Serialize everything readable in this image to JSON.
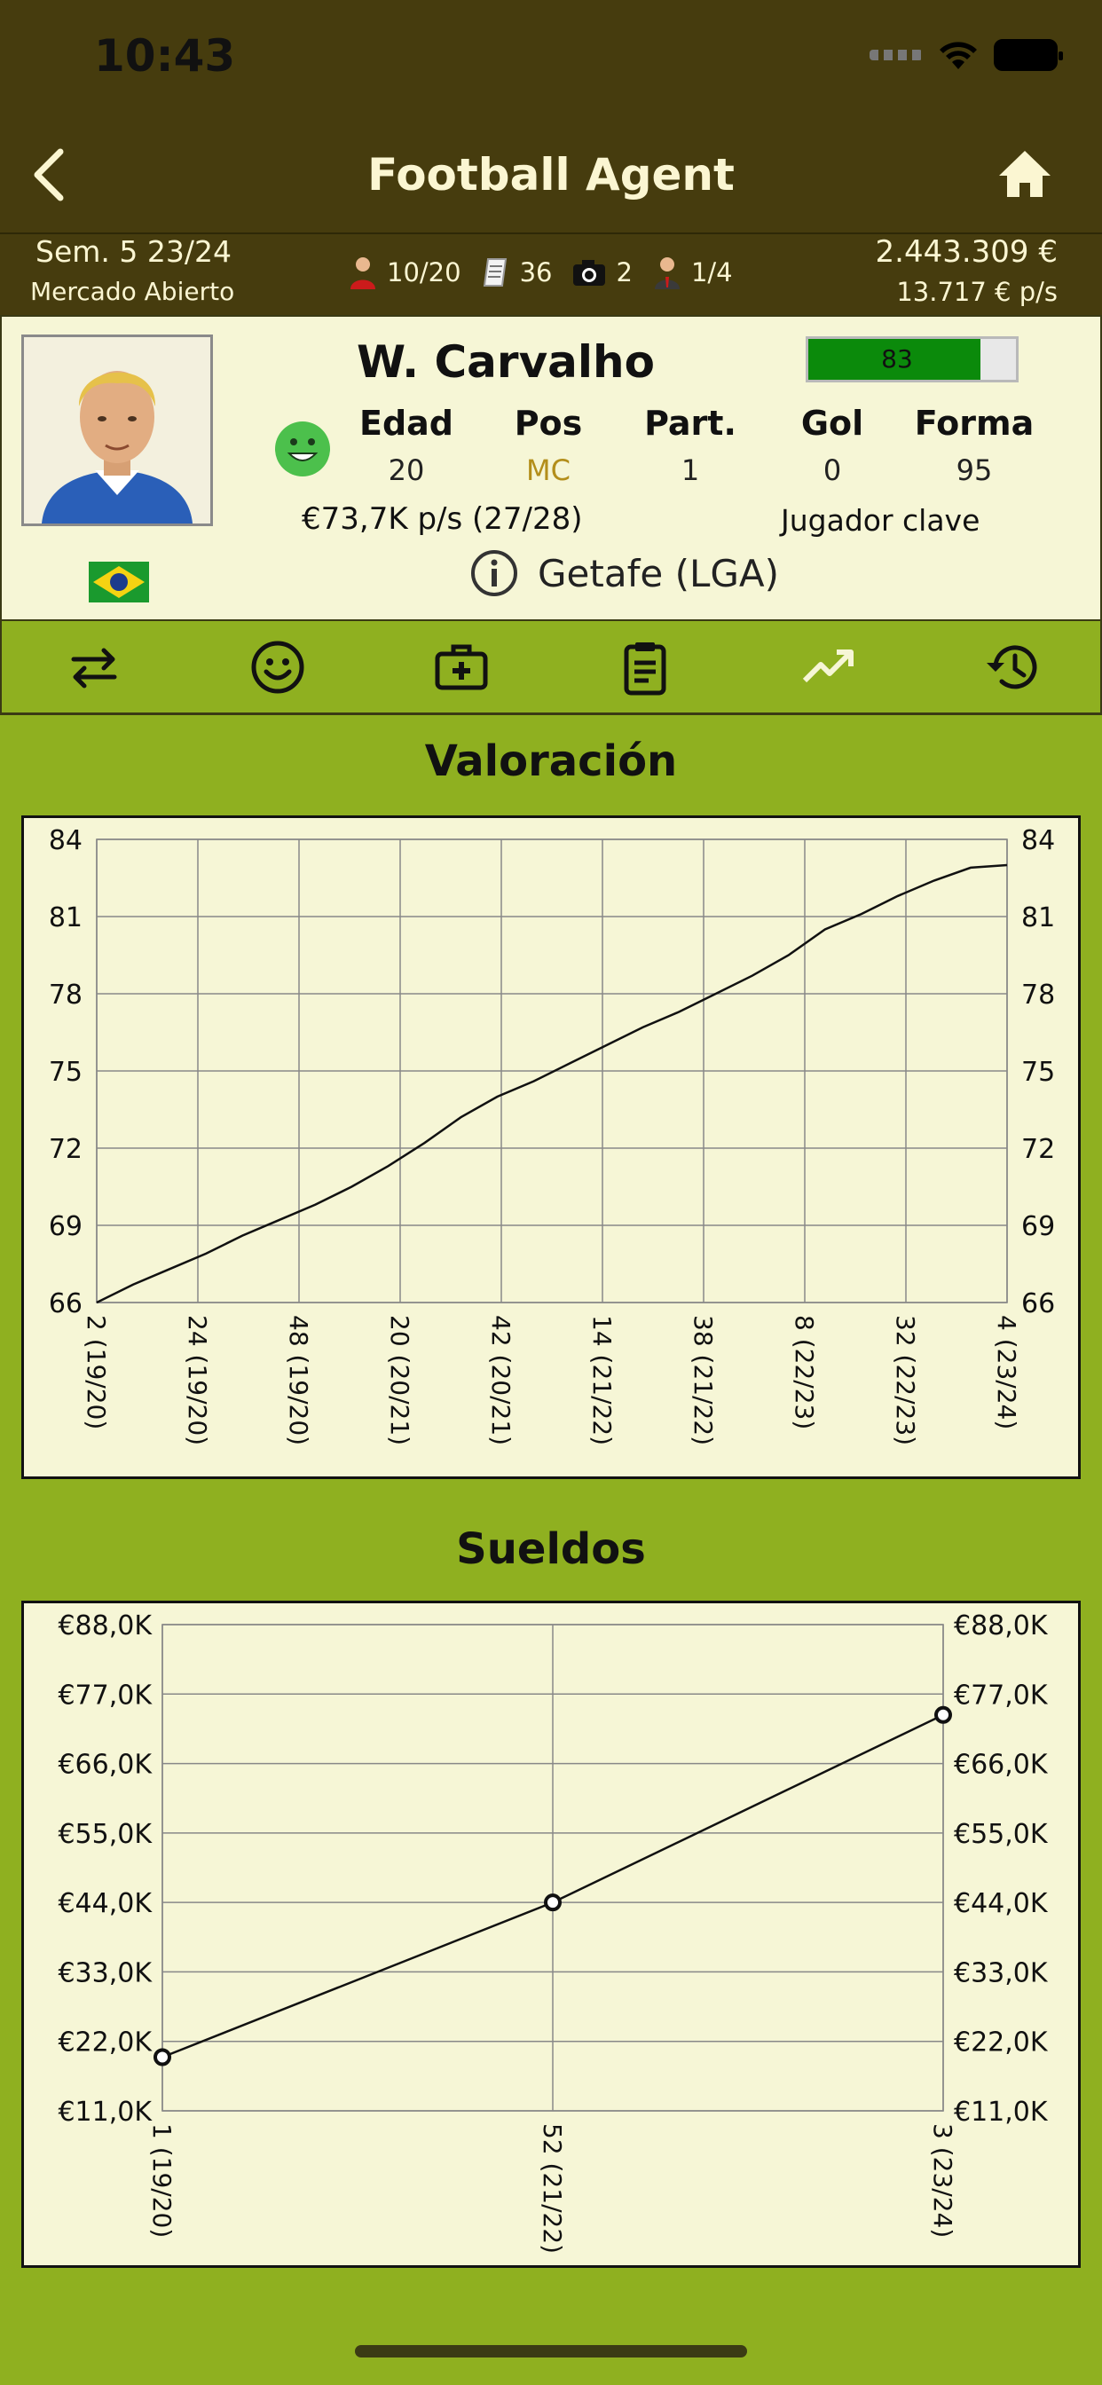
{
  "status_bar": {
    "time": "10:43"
  },
  "header": {
    "title": "Football Agent"
  },
  "info_bar": {
    "week": "Sem. 5 23/24",
    "market": "Mercado Abierto",
    "players": "10/20",
    "contracts": "36",
    "scouts": "2",
    "staff": "1/4",
    "balance": "2.443.309 €",
    "income": "13.717 € p/s"
  },
  "player": {
    "name": "W. Carvalho",
    "rating": "83",
    "rating_value": 83,
    "columns": [
      {
        "label": "Edad",
        "value": "20"
      },
      {
        "label": "Pos",
        "value": "MC"
      },
      {
        "label": "Part.",
        "value": "1"
      },
      {
        "label": "Gol",
        "value": "0"
      },
      {
        "label": "Forma",
        "value": "95"
      }
    ],
    "salary": "€73,7K p/s (27/28)",
    "role": "Jugador clave",
    "club": "Getafe (LGA)"
  },
  "tabs": [
    {
      "icon": "transfer-arrows-icon"
    },
    {
      "icon": "smiley-icon"
    },
    {
      "icon": "medical-kit-icon"
    },
    {
      "icon": "clipboard-icon"
    },
    {
      "icon": "trending-up-icon",
      "active": true
    },
    {
      "icon": "history-icon"
    }
  ],
  "colors": {
    "header_bg": "#463c0e",
    "panel_bg": "#f6f6d6",
    "accent_green": "#8fb020",
    "rating_green": "#0b8a0b",
    "position_gold": "#b38e1a"
  },
  "chart_data": [
    {
      "type": "line",
      "title": "Valoración",
      "ylim": [
        66,
        84
      ],
      "yticks": [
        "66",
        "69",
        "72",
        "75",
        "78",
        "81",
        "84"
      ],
      "xticks": [
        "2 (19/20)",
        "24 (19/20)",
        "48 (19/20)",
        "20 (20/21)",
        "42 (20/21)",
        "14 (21/22)",
        "38 (21/22)",
        "8 (22/23)",
        "32 (22/23)",
        "4 (23/24)"
      ],
      "grid": true,
      "values": [
        66.0,
        66.7,
        67.3,
        67.9,
        68.6,
        69.2,
        69.8,
        70.5,
        71.3,
        72.2,
        73.2,
        74.0,
        74.6,
        75.3,
        76.0,
        76.7,
        77.3,
        78.0,
        78.7,
        79.5,
        80.5,
        81.1,
        81.8,
        82.4,
        82.9,
        83.0
      ]
    },
    {
      "type": "line",
      "title": "Sueldos",
      "ylim": [
        11.0,
        88.0
      ],
      "yticks": [
        "€11,0K",
        "€22,0K",
        "€33,0K",
        "€44,0K",
        "€55,0K",
        "€66,0K",
        "€77,0K",
        "€88,0K"
      ],
      "categories": [
        "1 (19/20)",
        "52 (21/22)",
        "3 (23/24)"
      ],
      "values": [
        19.5,
        44.0,
        73.7
      ],
      "markers": true,
      "grid": true
    }
  ]
}
